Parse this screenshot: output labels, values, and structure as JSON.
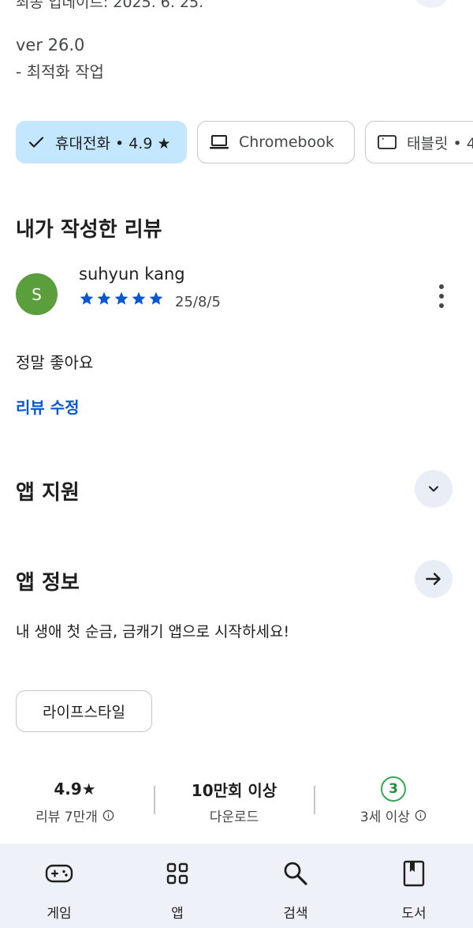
{
  "whats_new": {
    "updated_cut": "최종 업데이트: 2025. 6. 25.",
    "version": "ver 26.0",
    "changes": "- 최적화 작업"
  },
  "device_chips": [
    {
      "label": "휴대전화 • 4.9 ★",
      "selected": true,
      "icon": "check-icon"
    },
    {
      "label": "Chromebook",
      "selected": false,
      "icon": "laptop-icon"
    },
    {
      "label": "태블릿 • 4",
      "selected": false,
      "icon": "tablet-icon"
    }
  ],
  "my_review": {
    "title": "내가 작성한 리뷰",
    "avatar_letter": "S",
    "reviewer": "suhyun kang",
    "rating": 5,
    "date": "25/8/5",
    "text": "정말 좋아요",
    "edit_label": "리뷰 수정"
  },
  "app_support": {
    "title": "앱 지원"
  },
  "app_info": {
    "title": "앱 정보",
    "description": "내 생애 첫 순금, 금캐기 앱으로 시작하세요!",
    "category": "라이프스타일"
  },
  "stats": {
    "rating": "4.9★",
    "reviews": "리뷰 7만개",
    "downloads": "10만회 이상",
    "downloads_label": "다운로드",
    "age_number": "3",
    "age_label": "3세 이상"
  },
  "bottom_nav": [
    {
      "label": "게임",
      "icon": "gamepad-icon"
    },
    {
      "label": "앱",
      "icon": "apps-grid-icon"
    },
    {
      "label": "검색",
      "icon": "search-icon"
    },
    {
      "label": "도서",
      "icon": "book-icon"
    }
  ],
  "colors": {
    "accent": "#0b57d0",
    "selected_chip": "#c2e7ff",
    "avatar": "#5a9f3b",
    "nav_bg": "#eef1f7",
    "age_badge": "#34a853"
  }
}
